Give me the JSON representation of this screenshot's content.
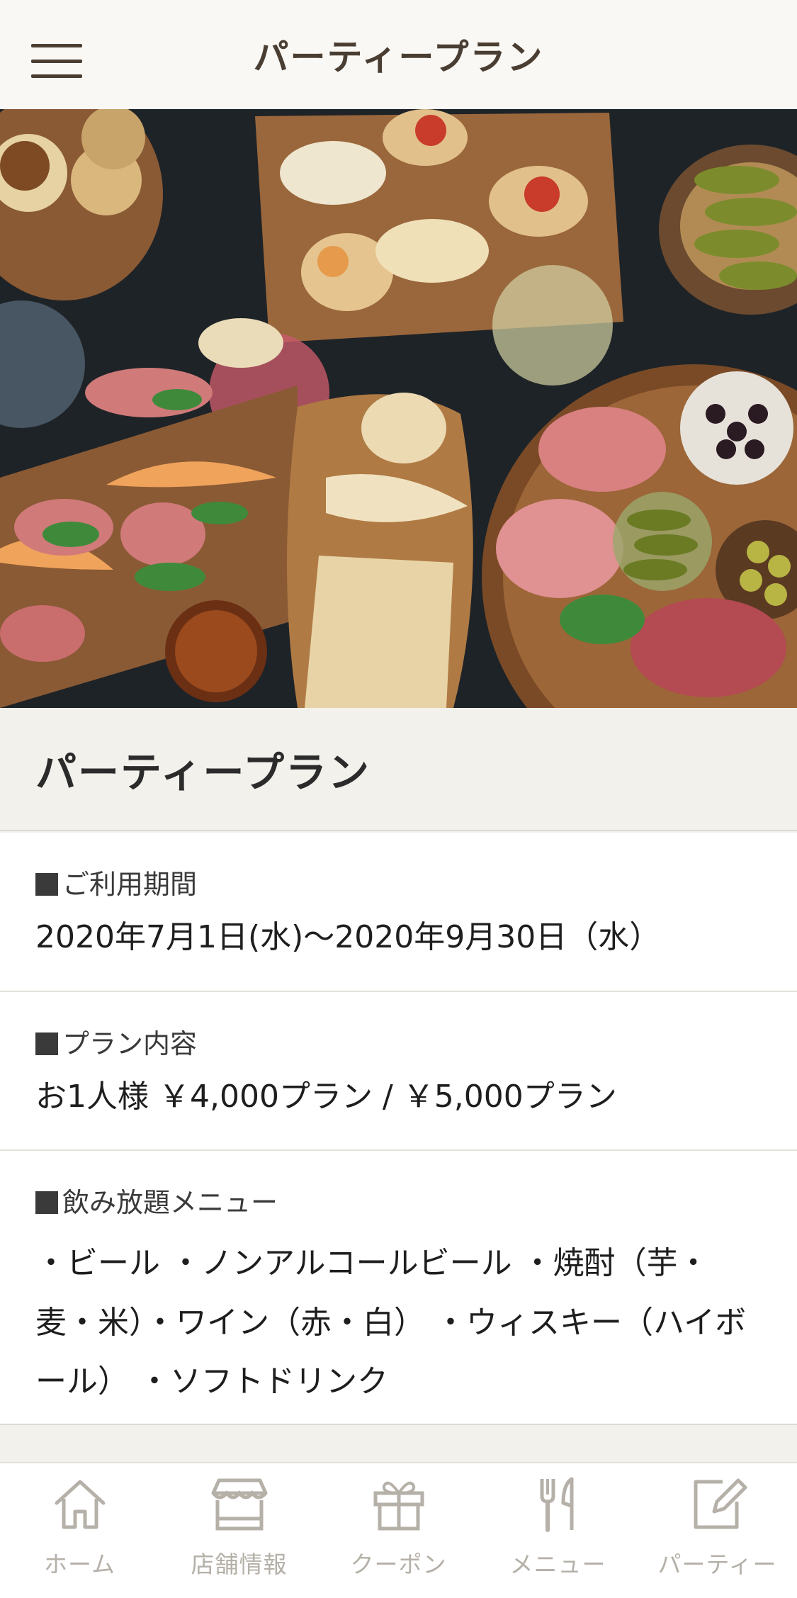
{
  "header": {
    "title": "パーティープラン"
  },
  "hero": {
    "icon": "food-platter-image"
  },
  "section": {
    "title": "パーティープラン"
  },
  "blocks": [
    {
      "label": "ご利用期間",
      "value": "2020年7月1日(水)〜2020年9月30日（水）"
    },
    {
      "label": "プラン内容",
      "value": "お1人様 ￥4,000プラン / ￥5,000プラン"
    },
    {
      "label": "飲み放題メニュー",
      "value": "・ビール ・ノンアルコールビール ・焼酎（芋・麦・米）・ワイン（赤・白） ・ウィスキー（ハイボール） ・ソフトドリンク"
    }
  ],
  "nav": [
    {
      "label": "ホーム",
      "icon": "home-icon"
    },
    {
      "label": "店舗情報",
      "icon": "store-icon"
    },
    {
      "label": "クーポン",
      "icon": "gift-icon"
    },
    {
      "label": "メニュー",
      "icon": "fork-knife-icon"
    },
    {
      "label": "パーティー",
      "icon": "edit-icon"
    }
  ],
  "colors": {
    "header_bg": "#faf8f4",
    "header_text": "#4a3e33",
    "page_bg": "#f3f1ec",
    "nav_icon": "#b5b0a8"
  }
}
